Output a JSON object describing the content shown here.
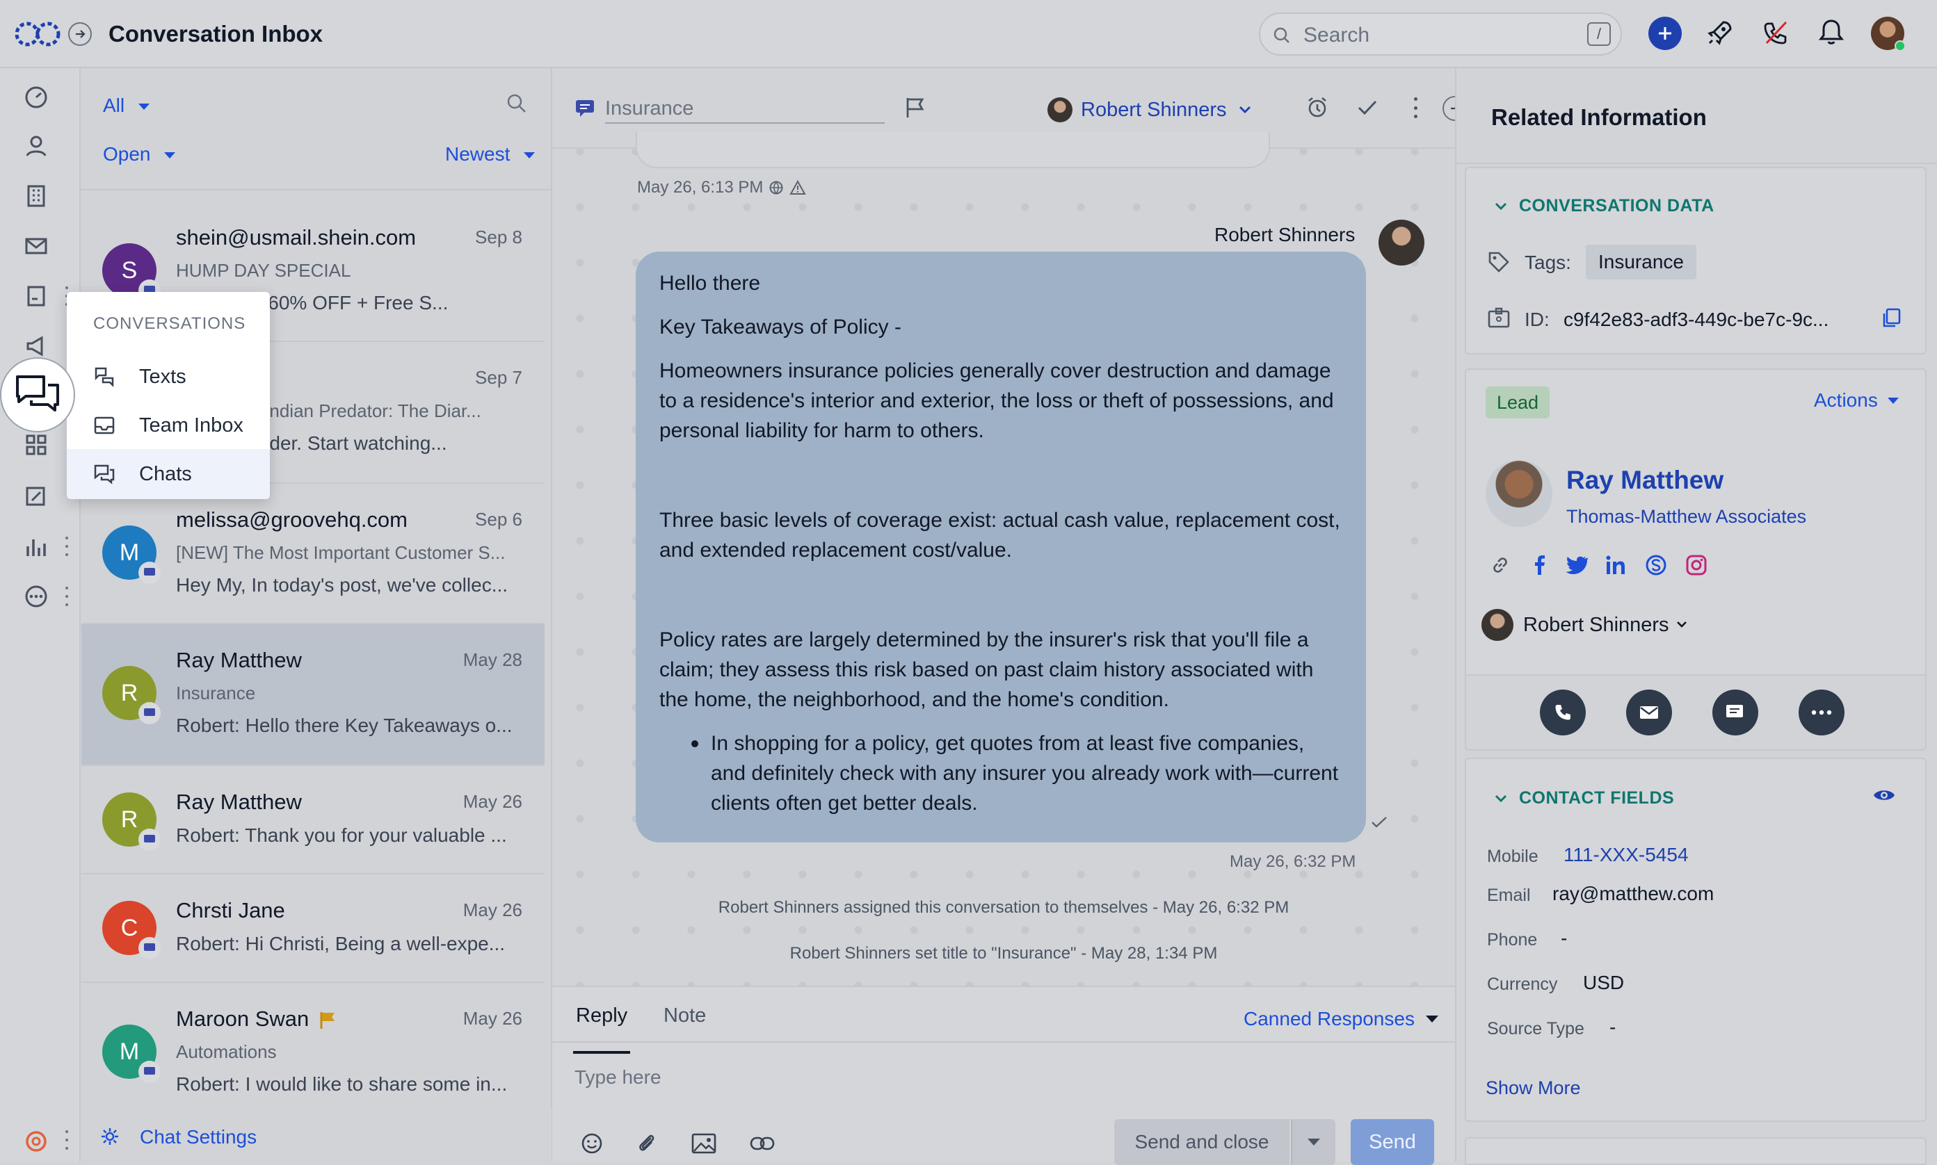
{
  "header": {
    "title": "Conversation Inbox",
    "search_placeholder": "Search",
    "search_shortcut": "/"
  },
  "filters": {
    "scope": "All",
    "status": "Open",
    "sort": "Newest"
  },
  "popup_menu": {
    "heading": "CONVERSATIONS",
    "items": [
      "Texts",
      "Team Inbox",
      "Chats"
    ]
  },
  "conversations": [
    {
      "avatar": "S",
      "name": "shein@usmail.shein.com",
      "date": "Sep 8",
      "subject": "HUMP DAY SPECIAL",
      "preview": "Buy 3 Get 60% OFF + Free S...",
      "color": "#5b2a86"
    },
    {
      "avatar": "",
      "name": "",
      "date": "Sep 7",
      "subject": "Reminder: Indian Predator: The Diar...",
      "preview": "Your reminder. Start watching...",
      "color": "#1f2937"
    },
    {
      "avatar": "M",
      "name": "melissa@groovehq.com",
      "date": "Sep 6",
      "subject": "[NEW] The Most Important Customer S...",
      "preview": "Hey My, In today's post, we've collec...",
      "color": "#1e7bbf"
    },
    {
      "avatar": "R",
      "name": "Ray Matthew",
      "date": "May 28",
      "subject": "Insurance",
      "preview": "Robert: Hello there Key Takeaways o...",
      "color": "#8a9a2d"
    },
    {
      "avatar": "R",
      "name": "Ray Matthew",
      "date": "May 26",
      "subject": "",
      "preview": "Robert: Thank you for your valuable ...",
      "color": "#8a9a2d"
    },
    {
      "avatar": "C",
      "name": "Chrsti Jane",
      "date": "May 26",
      "subject": "",
      "preview": "Robert: Hi Christi, Being a well-expe...",
      "color": "#d9442a"
    },
    {
      "avatar": "M",
      "name": "Maroon Swan",
      "date": "May 26",
      "subject": "Automations",
      "preview": "Robert: I would like to share some in...",
      "color": "#229a7b"
    }
  ],
  "chat_settings": "Chat Settings",
  "chat": {
    "title_placeholder": "Insurance",
    "assignee": "Robert Shinners",
    "prev_timestamp": "May 26, 6:13 PM",
    "sender": "Robert Shinners",
    "message": {
      "greeting": "Hello there",
      "heading": "Key Takeaways of Policy -",
      "p1": "Homeowners insurance policies generally cover destruction and damage to a residence's interior and exterior, the loss or theft of possessions, and personal liability for harm to others.",
      "p2": "Three basic levels of coverage exist: actual cash value, replacement cost, and extended replacement cost/value.",
      "p3": "Policy rates are largely determined by the insurer's risk that you'll file a claim; they assess this risk based on past claim history associated with the home, the neighborhood, and the home's condition.",
      "bullet": "In shopping for a policy, get quotes from at least five companies, and definitely check with any insurer you already work with—current clients often get better deals."
    },
    "message_timestamp": "May 26, 6:32 PM",
    "events": [
      "Robert Shinners assigned this conversation to themselves - May 26, 6:32 PM",
      "Robert Shinners set title to \"Insurance\" - May 28, 1:34 PM"
    ]
  },
  "composer": {
    "tab_reply": "Reply",
    "tab_note": "Note",
    "canned": "Canned Responses",
    "placeholder": "Type here",
    "send_close": "Send and close",
    "send": "Send"
  },
  "related": {
    "title": "Related Information",
    "conv_data_heading": "CONVERSATION DATA",
    "tags_label": "Tags:",
    "tag": "Insurance",
    "id_label": "ID:",
    "id_value": "c9f42e83-adf3-449c-be7c-9c...",
    "lead_badge": "Lead",
    "actions": "Actions",
    "contact_name": "Ray Matthew",
    "company": "Thomas-Matthew Associates",
    "owner": "Robert Shinners",
    "contact_fields_heading": "CONTACT FIELDS",
    "fields": [
      {
        "label": "Mobile",
        "value": "111-XXX-5454"
      },
      {
        "label": "Email",
        "value": "ray@matthew.com"
      },
      {
        "label": "Phone",
        "value": "-"
      },
      {
        "label": "Currency",
        "value": "USD"
      },
      {
        "label": "Source Type",
        "value": "-"
      }
    ],
    "show_more": "Show More"
  },
  "colors": {
    "accent": "#1d4ed8",
    "teal": "#0f766e",
    "brand_blue": "#1e40af"
  }
}
